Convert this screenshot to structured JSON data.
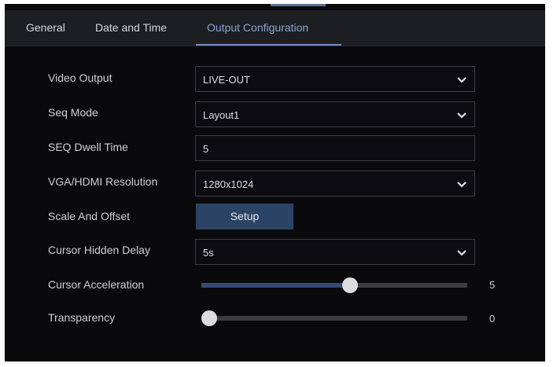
{
  "tabs": [
    {
      "label": "General",
      "active": false
    },
    {
      "label": "Date and Time",
      "active": false
    },
    {
      "label": "Output Configuration",
      "active": true
    }
  ],
  "form": {
    "video_output": {
      "label": "Video Output",
      "value": "LIVE-OUT"
    },
    "seq_mode": {
      "label": "Seq Mode",
      "value": "Layout1"
    },
    "seq_dwell_time": {
      "label": "SEQ Dwell Time",
      "value": "5"
    },
    "resolution": {
      "label": "VGA/HDMI Resolution",
      "value": "1280x1024"
    },
    "scale_offset": {
      "label": "Scale And Offset",
      "button_label": "Setup"
    },
    "cursor_hidden_delay": {
      "label": "Cursor Hidden Delay",
      "value": "5s"
    },
    "cursor_acceleration": {
      "label": "Cursor Acceleration",
      "value": "5",
      "fraction": 0.56
    },
    "transparency": {
      "label": "Transparency",
      "value": "0",
      "fraction": 0.03
    }
  },
  "colors": {
    "accent": "#86a4d4",
    "button": "#2b4364",
    "slider_fill": "#344a72",
    "background": "#0a0a0c"
  },
  "icons": {
    "dropdown": "chevron-down-icon"
  }
}
